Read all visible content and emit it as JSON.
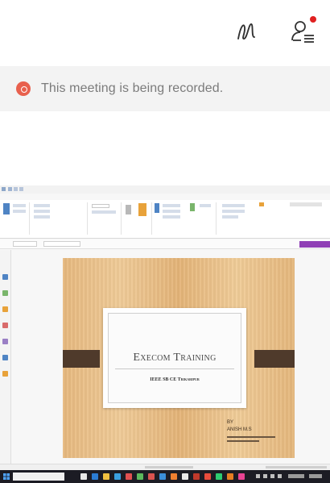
{
  "top_bar": {
    "whiteboard_icon": "squiggle-pen-icon",
    "participants_icon": "participants-icon",
    "participants_badge_color": "#e02020"
  },
  "recording_banner": {
    "text": "This meeting is being recorded.",
    "dot_color": "#e8604d"
  },
  "shared_screen": {
    "slide": {
      "title": "Execom Training",
      "subtitle": "IEEE SB CE Trikaripur",
      "byline_label": "BY",
      "presenter": "ANISH M.S"
    }
  }
}
